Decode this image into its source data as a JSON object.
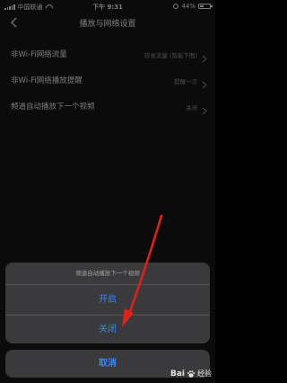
{
  "status_bar": {
    "carrier": "中国联通",
    "time": "下午 9:31",
    "battery": "44%",
    "battery_level": 0.44
  },
  "nav": {
    "title": "播放与网络设置"
  },
  "settings": [
    {
      "label": "非Wi-Fi网络流量",
      "value": "较省流量 (智能下图)"
    },
    {
      "label": "非Wi-Fi网络播放提醒",
      "value": "提醒一次"
    },
    {
      "label": "频道自动播放下一个视频",
      "value": "关闭"
    }
  ],
  "action_sheet": {
    "title": "频道自动播放下一个视频",
    "options": [
      "开启",
      "关闭"
    ],
    "cancel": "取消"
  },
  "watermark": {
    "logo": "Bai",
    "suffix": "经验",
    "icon": "baidu-paw-icon"
  },
  "colors": {
    "accent": "#3b84f4",
    "annotation": "#e0201a",
    "background": "#141414",
    "sheet": "#3a3a3c"
  }
}
